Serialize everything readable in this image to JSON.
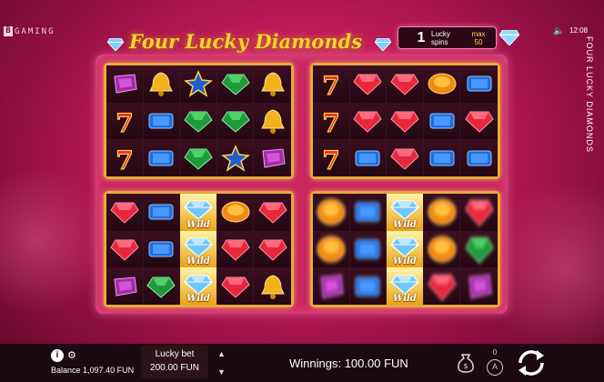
{
  "brand": {
    "letter": "B",
    "rest": "GAMING"
  },
  "title": "Four Lucky Diamonds",
  "side_title": "FOUR LUCKY DIAMONDS",
  "lucky_spins": {
    "count": "1",
    "label_1": "Lucky",
    "label_2": "spins",
    "max_label": "max",
    "max_value": "50"
  },
  "status": {
    "mute_icon": "🔈",
    "time": "12:08"
  },
  "wild_label": "Wild",
  "grids": [
    {
      "name": "top-left",
      "spinning": false,
      "cells": [
        [
          "gem-purple",
          "bell",
          "star",
          "gem-green",
          "bell"
        ],
        [
          "seven",
          "gem-blue",
          "gem-green",
          "gem-green",
          "bell"
        ],
        [
          "seven",
          "gem-blue",
          "gem-green",
          "star",
          "gem-purple"
        ]
      ]
    },
    {
      "name": "top-right",
      "spinning": false,
      "cells": [
        [
          "seven",
          "gem-red",
          "gem-red",
          "gem-orange",
          "gem-blue"
        ],
        [
          "seven",
          "gem-red",
          "gem-red",
          "gem-blue",
          "gem-red"
        ],
        [
          "seven",
          "gem-blue",
          "gem-red",
          "gem-blue",
          "gem-blue"
        ]
      ]
    },
    {
      "name": "bottom-left",
      "spinning": false,
      "cells": [
        [
          "gem-red",
          "gem-blue",
          "wild",
          "gem-orange",
          "gem-red"
        ],
        [
          "gem-red",
          "gem-blue",
          "wild",
          "gem-red",
          "gem-red"
        ],
        [
          "gem-purple",
          "gem-green",
          "wild",
          "gem-red",
          "bell"
        ]
      ]
    },
    {
      "name": "bottom-right",
      "spinning": true,
      "cells": [
        [
          "gem-orange",
          "gem-blue",
          "wild",
          "gem-orange",
          "gem-red"
        ],
        [
          "gem-orange",
          "gem-blue",
          "wild",
          "gem-orange",
          "gem-green"
        ],
        [
          "gem-purple",
          "gem-blue",
          "wild",
          "gem-red",
          "gem-purple"
        ]
      ]
    }
  ],
  "bottom": {
    "balance_label": "Balance",
    "balance_value": "1,097.40 FUN",
    "bet_label": "Lucky bet",
    "bet_value": "200.00 FUN",
    "winnings_label": "Winnings:",
    "winnings_value": "100.00 FUN",
    "autoplay_count": "0",
    "autoplay_letter": "A"
  },
  "colors": {
    "gold": "#e8a93a",
    "magenta": "#c41c5a",
    "bar": "#1c0a10"
  }
}
